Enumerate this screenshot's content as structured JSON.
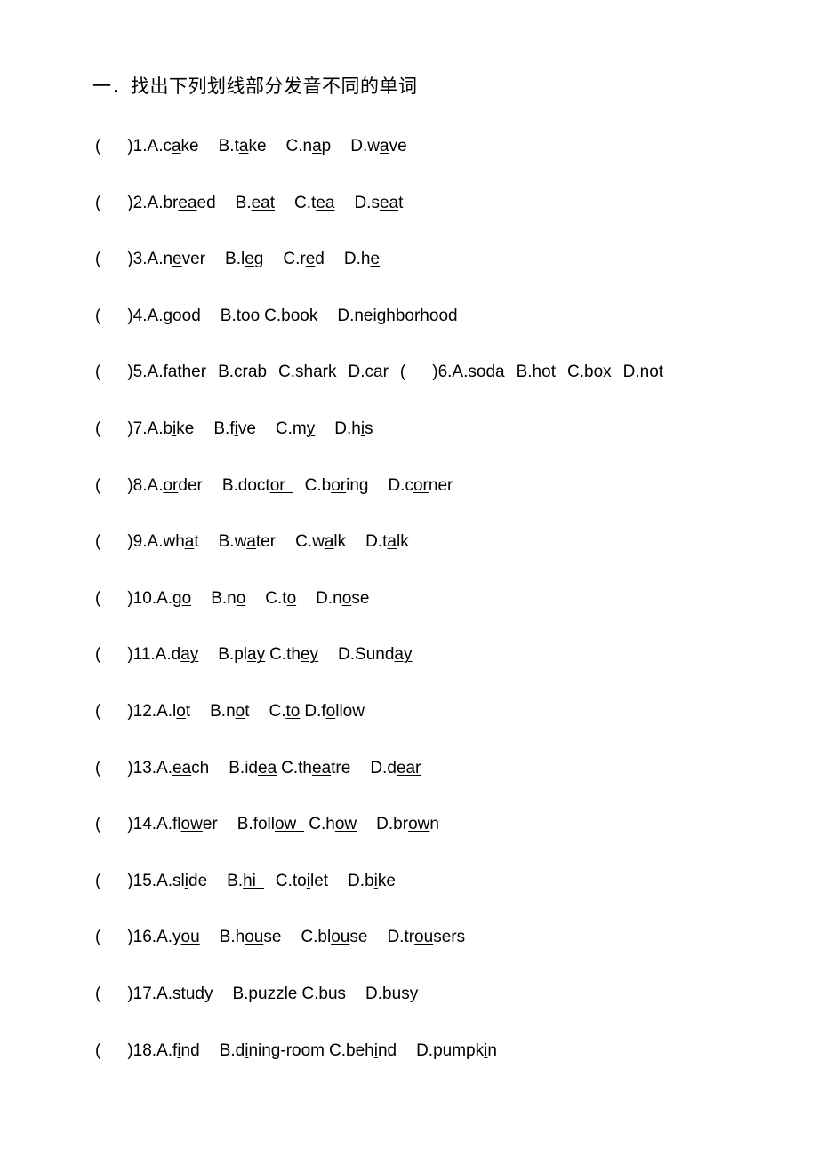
{
  "document": {
    "title": "一．找出下列划线部分发音不同的单词"
  },
  "questions": [
    {
      "blank": "(",
      "blank_close": ")",
      "number": "1.",
      "options": [
        {
          "label": "A.",
          "pre": "c",
          "mark": "a",
          "post": "ke",
          "gap": "lg"
        },
        {
          "label": "B.",
          "pre": "t",
          "mark": "a",
          "post": "ke",
          "gap": "lg"
        },
        {
          "label": "C.",
          "pre": "n",
          "mark": "a",
          "post": "p",
          "gap": "lg"
        },
        {
          "label": "D.",
          "pre": "w",
          "mark": "a",
          "post": "ve",
          "gap": ""
        }
      ]
    },
    {
      "blank": "(",
      "blank_close": ")",
      "number": "2.",
      "options": [
        {
          "label": "A.",
          "pre": "br",
          "mark": "ea",
          "post": "ed",
          "gap": "lg"
        },
        {
          "label": "B.",
          "pre": "",
          "mark": "eat",
          "post": "",
          "gap": "lg"
        },
        {
          "label": "C.",
          "pre": "t",
          "mark": "ea",
          "post": "",
          "gap": "lg"
        },
        {
          "label": "D.",
          "pre": "s",
          "mark": "ea",
          "post": "t",
          "gap": ""
        }
      ]
    },
    {
      "blank": "(",
      "blank_close": ")",
      "number": "3.",
      "options": [
        {
          "label": "A.",
          "pre": "n",
          "mark": "e",
          "post": "ver",
          "gap": "lg"
        },
        {
          "label": "B.",
          "pre": "l",
          "mark": "e",
          "post": "g",
          "gap": "lg"
        },
        {
          "label": "C.",
          "pre": "r",
          "mark": "e",
          "post": "d",
          "gap": "lg"
        },
        {
          "label": "D.",
          "pre": "h",
          "mark": "e",
          "post": "",
          "gap": ""
        }
      ]
    },
    {
      "blank": "(",
      "blank_close": ")",
      "number": "4.",
      "options": [
        {
          "label": "A.",
          "pre": "g",
          "mark": "oo",
          "post": "d",
          "gap": "lg"
        },
        {
          "label": "B.",
          "pre": "t",
          "mark": "oo",
          "post": "",
          "gap": "sm"
        },
        {
          "label": "C.",
          "pre": "b",
          "mark": "oo",
          "post": "k",
          "gap": "lg"
        },
        {
          "label": "D.",
          "pre": "neighborh",
          "mark": "oo",
          "post": "d",
          "gap": ""
        }
      ]
    },
    {
      "blank": "(",
      "blank_close": ")",
      "number": "5.",
      "options": [
        {
          "label": "A.",
          "pre": "f",
          "mark": "a",
          "post": "ther",
          "gap": "md"
        },
        {
          "label": "B.",
          "pre": "cr",
          "mark": "a",
          "post": "b",
          "gap": "md"
        },
        {
          "label": "C.",
          "pre": "sh",
          "mark": "ar",
          "post": "k",
          "gap": "md"
        },
        {
          "label": "D.",
          "pre": "c",
          "mark": "ar",
          "post": "",
          "gap": ""
        }
      ],
      "second": {
        "blank": "(",
        "blank_close": ")",
        "number": "6.",
        "options": [
          {
            "label": "A.",
            "pre": "s",
            "mark": "o",
            "post": "da",
            "gap": "md"
          },
          {
            "label": "B.",
            "pre": "h",
            "mark": "o",
            "post": "t",
            "gap": "md"
          },
          {
            "label": "C.",
            "pre": "b",
            "mark": "o",
            "post": "x",
            "gap": "md"
          },
          {
            "label": "D.",
            "pre": "n",
            "mark": "o",
            "post": "t",
            "gap": ""
          }
        ]
      }
    },
    {
      "blank": "(",
      "blank_close": ")",
      "number": "7.",
      "options": [
        {
          "label": "A.",
          "pre": "b",
          "mark": "i",
          "post": "ke",
          "gap": "lg"
        },
        {
          "label": "B.",
          "pre": "f",
          "mark": "i",
          "post": "ve",
          "gap": "lg"
        },
        {
          "label": "C.",
          "pre": "m",
          "mark": "y",
          "post": "",
          "gap": "lg"
        },
        {
          "label": "D.",
          "pre": "h",
          "mark": "i",
          "post": "s",
          "gap": ""
        }
      ]
    },
    {
      "blank": "(",
      "blank_close": ")",
      "number": "8.",
      "options": [
        {
          "label": "A.",
          "pre": "",
          "mark": "or",
          "post": "der",
          "gap": "lg"
        },
        {
          "label": "B.",
          "pre": "doct",
          "mark": "or",
          "post": "",
          "trail_underline": true,
          "gap": "md"
        },
        {
          "label": "C.",
          "pre": "b",
          "mark": "or",
          "post": "ing",
          "gap": "lg"
        },
        {
          "label": "D.",
          "pre": "c",
          "mark": "or",
          "post": "ner",
          "gap": ""
        }
      ]
    },
    {
      "blank": "(",
      "blank_close": ")",
      "number": "9.",
      "options": [
        {
          "label": "A.",
          "pre": "wh",
          "mark": "a",
          "post": "t",
          "gap": "lg"
        },
        {
          "label": "B.",
          "pre": "w",
          "mark": "a",
          "post": "ter",
          "gap": "lg"
        },
        {
          "label": "C.",
          "pre": "w",
          "mark": "a",
          "post": "lk",
          "gap": "lg"
        },
        {
          "label": "D.",
          "pre": "t",
          "mark": "a",
          "post": "lk",
          "gap": ""
        }
      ]
    },
    {
      "blank": "(",
      "blank_close": ")",
      "number": "10.",
      "options": [
        {
          "label": "A.",
          "pre": "g",
          "mark": "o",
          "post": "",
          "gap": "lg"
        },
        {
          "label": "B.",
          "pre": "n",
          "mark": "o",
          "post": "",
          "gap": "lg"
        },
        {
          "label": "C.",
          "pre": "t",
          "mark": "o",
          "post": "",
          "gap": "lg"
        },
        {
          "label": "D.",
          "pre": "n",
          "mark": "o",
          "post": "se",
          "gap": ""
        }
      ]
    },
    {
      "blank": "(",
      "blank_close": ")",
      "number": "11.",
      "options": [
        {
          "label": "A.",
          "pre": "d",
          "mark": "ay",
          "post": "",
          "gap": "lg"
        },
        {
          "label": "B.",
          "pre": "pl",
          "mark": "ay",
          "post": "",
          "gap": "sm"
        },
        {
          "label": "C.",
          "pre": "th",
          "mark": "ey",
          "post": "",
          "gap": "lg"
        },
        {
          "label": "D.",
          "pre": "Sund",
          "mark": "ay",
          "post": "",
          "gap": ""
        }
      ]
    },
    {
      "blank": "(",
      "blank_close": ")",
      "number": "12.",
      "options": [
        {
          "label": "A.",
          "pre": "l",
          "mark": "o",
          "post": "t",
          "gap": "lg"
        },
        {
          "label": "B.",
          "pre": "n",
          "mark": "o",
          "post": "t",
          "gap": "lg"
        },
        {
          "label": "C.",
          "pre": "",
          "mark": "to",
          "post": "",
          "gap": "sm"
        },
        {
          "label": "D.",
          "pre": "f",
          "mark": "o",
          "post": "llow",
          "gap": ""
        }
      ]
    },
    {
      "blank": "(",
      "blank_close": ")",
      "number": "13.",
      "options": [
        {
          "label": "A.",
          "pre": "",
          "mark": "ea",
          "post": "ch",
          "gap": "lg"
        },
        {
          "label": "B.",
          "pre": "id",
          "mark": "ea",
          "post": "",
          "gap": "sm"
        },
        {
          "label": "C.",
          "pre": "th",
          "mark": "ea",
          "post": "tre",
          "gap": "lg"
        },
        {
          "label": "D.",
          "pre": "d",
          "mark": "ear",
          "post": "",
          "gap": ""
        }
      ]
    },
    {
      "blank": "(",
      "blank_close": ")",
      "number": "14.",
      "options": [
        {
          "label": "A.",
          "pre": "fl",
          "mark": "ow",
          "post": "er",
          "gap": "lg"
        },
        {
          "label": "B.",
          "pre": "foll",
          "mark": "ow",
          "post": "",
          "trail_underline": true,
          "gap": "sm"
        },
        {
          "label": "C.",
          "pre": "h",
          "mark": "ow",
          "post": "",
          "gap": "lg"
        },
        {
          "label": "D.",
          "pre": "br",
          "mark": "ow",
          "post": "n",
          "gap": ""
        }
      ]
    },
    {
      "blank": "(",
      "blank_close": ")",
      "number": "15.",
      "options": [
        {
          "label": "A.",
          "pre": "sl",
          "mark": "i",
          "post": "de",
          "gap": "lg"
        },
        {
          "label": "B.",
          "pre": "",
          "mark": "hi",
          "post": "",
          "trail_underline": true,
          "gap": "md"
        },
        {
          "label": "C.",
          "pre": "to",
          "mark": "i",
          "post": "let",
          "gap": "lg"
        },
        {
          "label": "D.",
          "pre": "b",
          "mark": "i",
          "post": "ke",
          "gap": ""
        }
      ]
    },
    {
      "blank": "(",
      "blank_close": ")",
      "number": "16.",
      "options": [
        {
          "label": "A.",
          "pre": "y",
          "mark": "ou",
          "post": "",
          "gap": "lg"
        },
        {
          "label": "B.",
          "pre": "h",
          "mark": "ou",
          "post": "se",
          "gap": "lg"
        },
        {
          "label": "C.",
          "pre": "bl",
          "mark": "ou",
          "post": "se",
          "gap": "lg"
        },
        {
          "label": "D.",
          "pre": "tr",
          "mark": "ou",
          "post": "sers",
          "gap": ""
        }
      ]
    },
    {
      "blank": "(",
      "blank_close": ")",
      "number": "17.",
      "options": [
        {
          "label": "A.",
          "pre": "st",
          "mark": "u",
          "post": "dy",
          "gap": "lg"
        },
        {
          "label": "B.",
          "pre": "p",
          "mark": "u",
          "post": "zzle",
          "gap": "sm"
        },
        {
          "label": "C.",
          "pre": "b",
          "mark": "us",
          "post": "",
          "gap": "lg"
        },
        {
          "label": "D.",
          "pre": "b",
          "mark": "u",
          "post": "sy",
          "gap": ""
        }
      ]
    },
    {
      "blank": "(",
      "blank_close": ")",
      "number": "18.",
      "options": [
        {
          "label": "A.",
          "pre": "f",
          "mark": "i",
          "post": "nd",
          "gap": "lg"
        },
        {
          "label": "B.",
          "pre": "d",
          "mark": "i",
          "post": "ning-room",
          "gap": "sm"
        },
        {
          "label": "C.",
          "pre": "beh",
          "mark": "i",
          "post": "nd",
          "gap": "lg"
        },
        {
          "label": "D.",
          "pre": "pumpk",
          "mark": "i",
          "post": "n",
          "gap": ""
        }
      ]
    }
  ]
}
